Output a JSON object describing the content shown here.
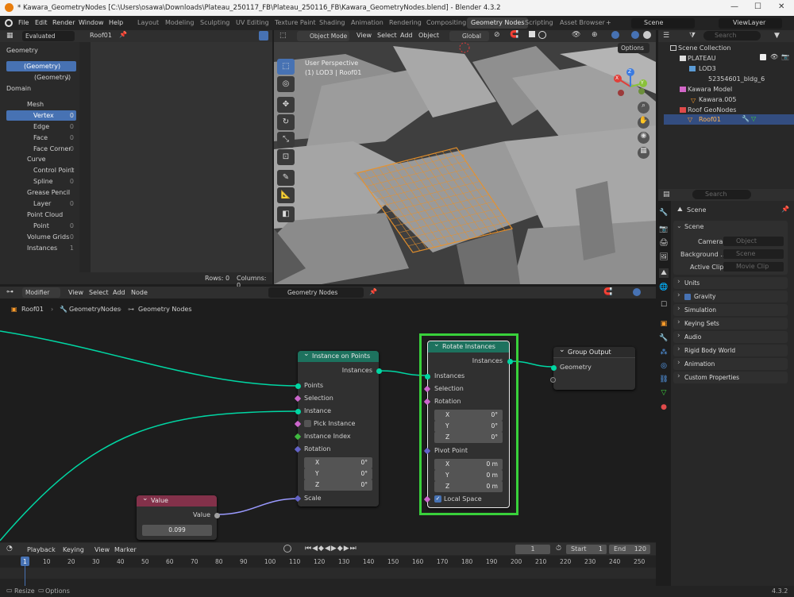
{
  "titlebar": {
    "title": "* Kawara_GeometryNodes [C:\\Users\\osawa\\Downloads\\Plateau_250117_FB\\Plateau_250116_FB\\Kawara_GeometryNodes.blend] - Blender 4.3.2",
    "minimize": "—",
    "maximize": "☐",
    "close": "✕"
  },
  "menu": {
    "items": [
      "File",
      "Edit",
      "Render",
      "Window",
      "Help"
    ],
    "workspaces": [
      "Layout",
      "Modeling",
      "Sculpting",
      "UV Editing",
      "Texture Paint",
      "Shading",
      "Animation",
      "Rendering",
      "Compositing",
      "Geometry Nodes",
      "Scripting",
      "Asset Browser"
    ],
    "add_ws": "+",
    "scene": "Scene",
    "view_layer": "ViewLayer"
  },
  "spreadsheet": {
    "evaluated": "Evaluated",
    "object": "Roof01",
    "geometry_header": "Geometry",
    "geometry_items": [
      {
        "label": "(Geometry)",
        "count": ""
      },
      {
        "label": "(Geometry)",
        "count": "1"
      }
    ],
    "domain_header": "Domain",
    "domain_items": [
      {
        "label": "Mesh",
        "count": ""
      },
      {
        "label": "Vertex",
        "count": "0"
      },
      {
        "label": "Edge",
        "count": "0"
      },
      {
        "label": "Face",
        "count": "0"
      },
      {
        "label": "Face Corner",
        "count": "0"
      },
      {
        "label": "Curve",
        "count": ""
      },
      {
        "label": "Control Point",
        "count": "0"
      },
      {
        "label": "Spline",
        "count": "0"
      },
      {
        "label": "Grease Pencil",
        "count": ""
      },
      {
        "label": "Layer",
        "count": "0"
      },
      {
        "label": "Point Cloud",
        "count": ""
      },
      {
        "label": "Point",
        "count": "0"
      },
      {
        "label": "Volume Grids",
        "count": "0"
      },
      {
        "label": "Instances",
        "count": "1"
      }
    ],
    "rows": "Rows: 0",
    "columns": "Columns: 0"
  },
  "viewport": {
    "mode": "Object Mode",
    "menus": [
      "View",
      "Select",
      "Add",
      "Object"
    ],
    "orientation": "Global",
    "overlay_title": "User Perspective",
    "overlay_sub": "(1) LOD3 | Roof01",
    "options": "Options",
    "axes": {
      "x": "X",
      "y": "Y",
      "z": "Z"
    }
  },
  "outliner": {
    "search": "Search",
    "items": [
      {
        "label": "Scene Collection"
      },
      {
        "label": "PLATEAU"
      },
      {
        "label": "LOD3"
      },
      {
        "label": "52354601_bldg_6"
      },
      {
        "label": "Kawara Model"
      },
      {
        "label": "Kawara.005"
      },
      {
        "label": "Roof GeoNodes"
      },
      {
        "label": "Roof01"
      }
    ]
  },
  "properties": {
    "search": "Search",
    "context": "Scene",
    "section": "Scene",
    "camera_label": "Camera",
    "camera_value": "Object",
    "background_label": "Background ...",
    "background_value": "Scene",
    "clip_label": "Active Clip",
    "clip_value": "Movie Clip",
    "sections": [
      "Units",
      "Gravity",
      "Simulation",
      "Keying Sets",
      "Audio",
      "Rigid Body World",
      "Animation",
      "Custom Properties"
    ]
  },
  "node_editor": {
    "modifier": "Modifier",
    "menus": [
      "View",
      "Select",
      "Add",
      "Node"
    ],
    "tree": "Geometry Nodes",
    "breadcrumb": [
      "Roof01",
      "GeometryNodes",
      "Geometry Nodes"
    ],
    "iop": {
      "title": "Instance on Points",
      "out": "Instances",
      "inputs": [
        "Points",
        "Selection",
        "Instance",
        "Pick Instance",
        "Instance Index",
        "Rotation"
      ],
      "rx": "X",
      "ry": "Y",
      "rz": "Z",
      "rxv": "0°",
      "ryv": "0°",
      "rzv": "0°",
      "scale": "Scale"
    },
    "rot": {
      "title": "Rotate Instances",
      "out": "Instances",
      "inputs": [
        "Instances",
        "Selection",
        "Rotation"
      ],
      "rxv": "0°",
      "ryv": "0°",
      "rzv": "0°",
      "pivot": "Pivot Point",
      "pxv": "0 m",
      "pyv": "0 m",
      "pzv": "0 m",
      "local": "Local Space"
    },
    "out": {
      "title": "Group Output",
      "in": "Geometry"
    },
    "value": {
      "title": "Value",
      "out": "Value",
      "val": "0.099"
    }
  },
  "timeline": {
    "menus": [
      "Playback",
      "Keying",
      "View",
      "Marker"
    ],
    "frame": "1",
    "start_label": "Start",
    "start": "1",
    "end_label": "End",
    "end": "120",
    "ticks": [
      "1",
      "10",
      "20",
      "30",
      "40",
      "50",
      "60",
      "70",
      "80",
      "90",
      "100",
      "110",
      "120",
      "130",
      "140",
      "150",
      "160",
      "170",
      "180",
      "190",
      "200",
      "210",
      "220",
      "230",
      "240",
      "250"
    ]
  },
  "status": {
    "resize": "Resize",
    "options": "Options",
    "version": "4.3.2"
  },
  "colors": {
    "accent": "#4772b3",
    "node_geo": "#1d725e",
    "node_value": "#83314a",
    "highlight": "#39d13b"
  }
}
